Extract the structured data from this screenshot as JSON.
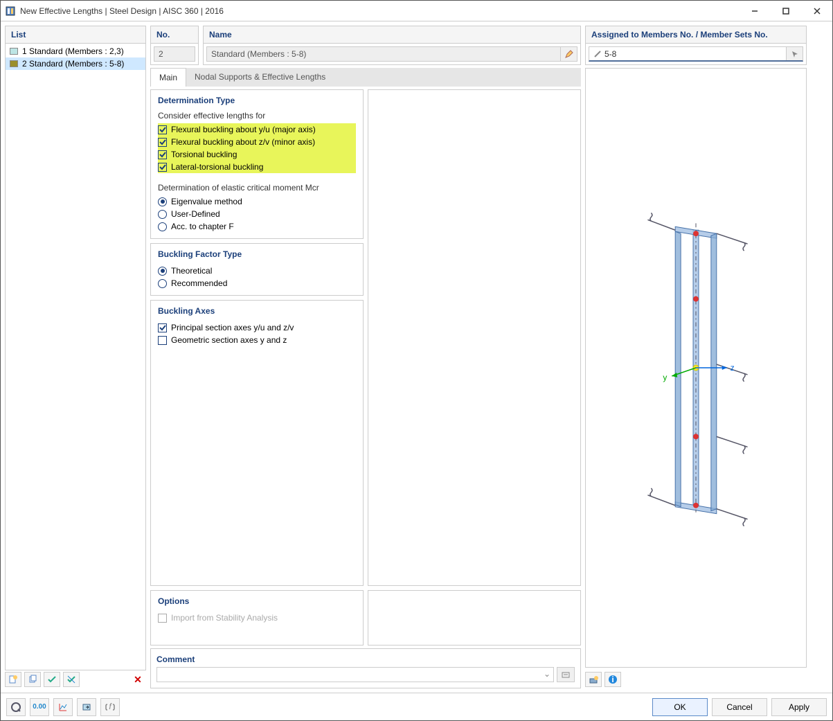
{
  "window": {
    "title": "New Effective Lengths | Steel Design | AISC 360 | 2016"
  },
  "list": {
    "header": "List",
    "items": [
      {
        "swatch": "#bde5e5",
        "label": "1 Standard (Members : 2,3)"
      },
      {
        "swatch": "#9b8f2c",
        "label": "2 Standard (Members : 5-8)"
      }
    ],
    "selected": 1
  },
  "header": {
    "no_label": "No.",
    "no_value": "2",
    "name_label": "Name",
    "name_value": "Standard (Members : 5-8)",
    "assigned_label": "Assigned to Members No. / Member Sets No.",
    "assigned_value": "5-8"
  },
  "tabs": {
    "items": [
      "Main",
      "Nodal Supports & Effective Lengths"
    ],
    "active": 0
  },
  "determination": {
    "header": "Determination Type",
    "sub1": "Consider effective lengths for",
    "checks": [
      "Flexural buckling about y/u (major axis)",
      "Flexural buckling about z/v (minor axis)",
      "Torsional buckling",
      "Lateral-torsional buckling"
    ],
    "sub2": "Determination of elastic critical moment Mcr",
    "radios": [
      "Eigenvalue method",
      "User-Defined",
      "Acc. to chapter F"
    ],
    "radio_sel": 0
  },
  "factor": {
    "header": "Buckling Factor Type",
    "radios": [
      "Theoretical",
      "Recommended"
    ],
    "radio_sel": 0
  },
  "axes": {
    "header": "Buckling Axes",
    "checks": [
      {
        "label": "Principal section axes y/u and z/v",
        "on": true
      },
      {
        "label": "Geometric section axes y and z",
        "on": false
      }
    ]
  },
  "options": {
    "header": "Options",
    "check_label": "Import from Stability Analysis"
  },
  "comment": {
    "header": "Comment"
  },
  "preview_labels": {
    "y": "y",
    "z": "z"
  },
  "footer": {
    "ok": "OK",
    "cancel": "Cancel",
    "apply": "Apply"
  }
}
